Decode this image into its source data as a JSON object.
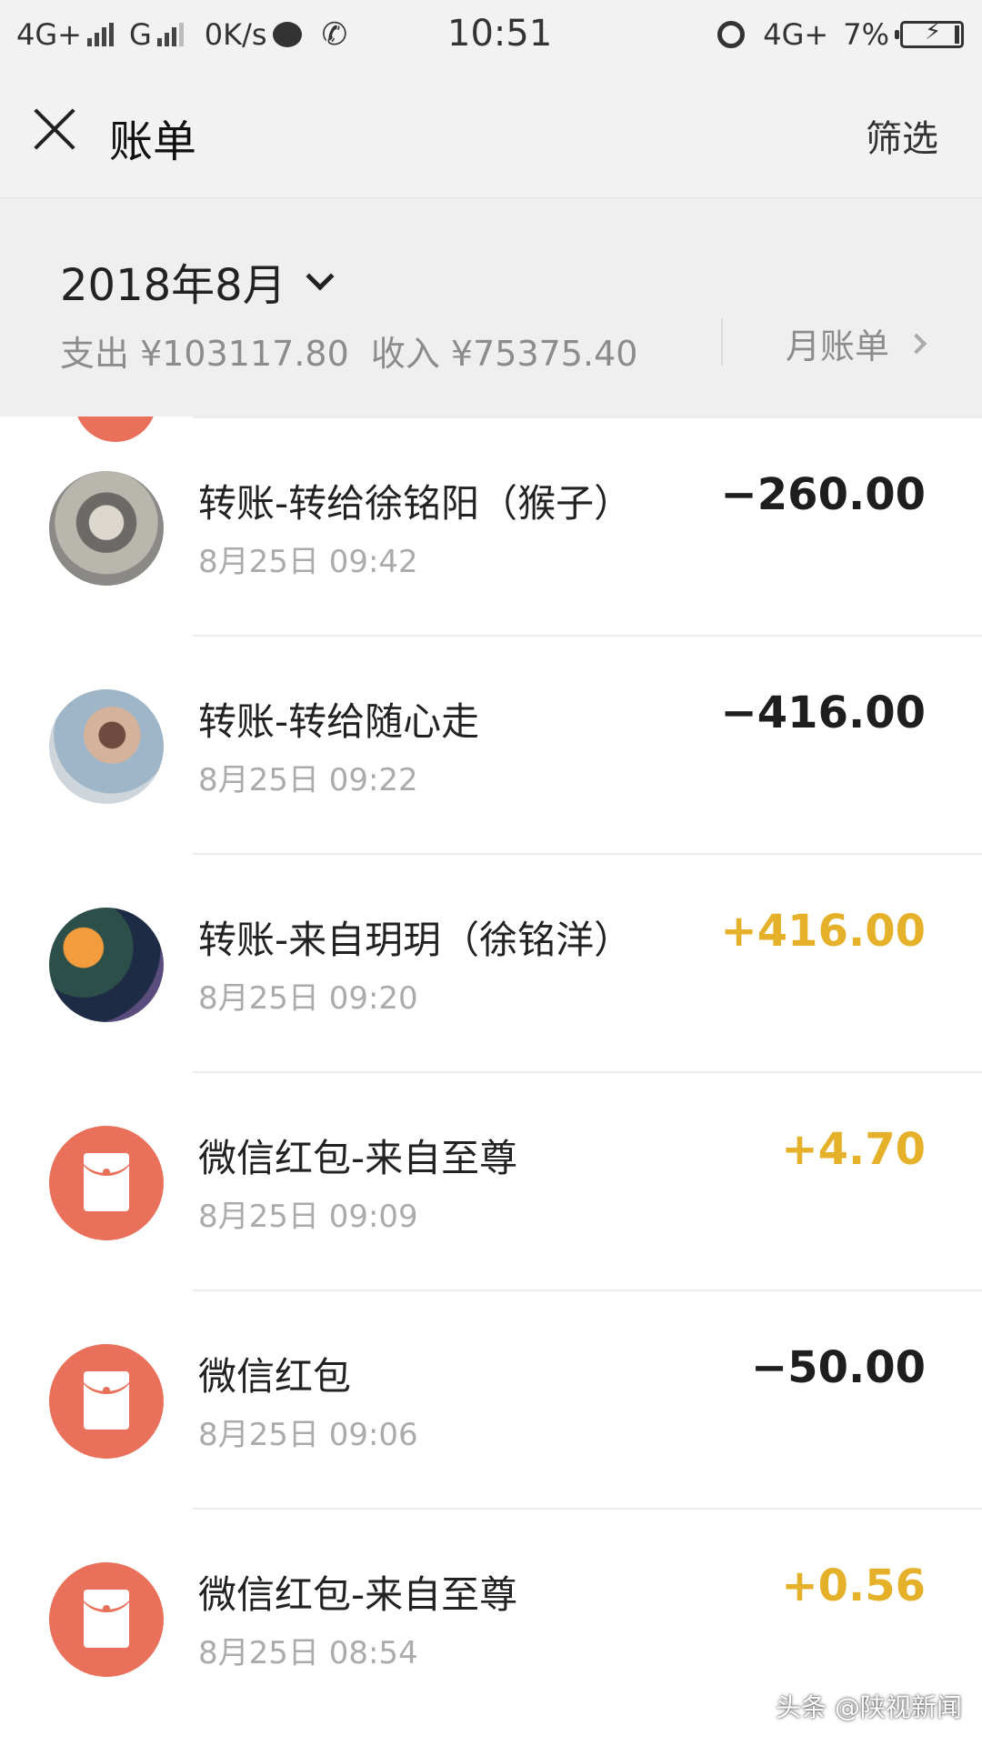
{
  "status_bar": {
    "network1": "4G+",
    "network2": "G",
    "speed": "0K/s",
    "time": "10:51",
    "network3": "4G+",
    "battery": "7%"
  },
  "nav": {
    "title": "账单",
    "filter_label": "筛选"
  },
  "month_header": {
    "month": "2018年8月",
    "expense": "支出 ¥103117.80",
    "income": "收入 ¥75375.40",
    "monthly_bill_label": "月账单"
  },
  "colors": {
    "income": "#e6b12a",
    "expense": "#1e1e1e",
    "red_packet": "#e9705a"
  },
  "transactions": [
    {
      "title": "转账-转给徐铭阳（猴子）",
      "time": "8月25日 09:42",
      "amount": "−260.00",
      "direction": "out",
      "icon": "avatar-photo"
    },
    {
      "title": "转账-转给随心走",
      "time": "8月25日 09:22",
      "amount": "−416.00",
      "direction": "out",
      "icon": "avatar-photo"
    },
    {
      "title": "转账-来自玥玥（徐铭洋）",
      "time": "8月25日 09:20",
      "amount": "+416.00",
      "direction": "in",
      "icon": "avatar-photo"
    },
    {
      "title": "微信红包-来自至尊",
      "time": "8月25日 09:09",
      "amount": "+4.70",
      "direction": "in",
      "icon": "red-packet-icon"
    },
    {
      "title": "微信红包",
      "time": "8月25日 09:06",
      "amount": "−50.00",
      "direction": "out",
      "icon": "red-packet-icon"
    },
    {
      "title": "微信红包-来自至尊",
      "time": "8月25日 08:54",
      "amount": "+0.56",
      "direction": "in",
      "icon": "red-packet-icon"
    }
  ],
  "watermark": "头条 @陕视新闻"
}
